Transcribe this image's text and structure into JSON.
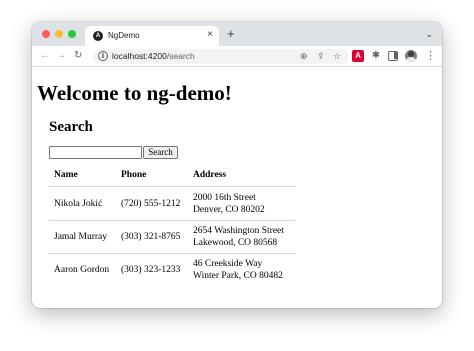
{
  "browser": {
    "tab_title": "NgDemo",
    "tab_favicon": "A",
    "tab_close": "×",
    "new_tab": "+",
    "tab_menu": "⌄",
    "url_host": "localhost:4200",
    "url_path": "/search",
    "icons": [
      "back-arrow-icon",
      "forward-arrow-icon",
      "reload-icon",
      "site-info-icon",
      "zoom-icon",
      "share-icon",
      "star-icon",
      "angular-extension-icon",
      "puzzle-extension-icon",
      "side-panel-icon",
      "profile-avatar",
      "kebab-menu-icon"
    ]
  },
  "page": {
    "heading": "Welcome to ng-demo!",
    "section_title": "Search",
    "search_value": "",
    "search_button": "Search"
  },
  "table": {
    "headers": [
      "Name",
      "Phone",
      "Address"
    ],
    "rows": [
      {
        "name": "Nikola Jokić",
        "phone": "(720) 555-1212",
        "address_line1": "2000 16th Street",
        "address_line2": "Denver, CO 80202"
      },
      {
        "name": "Jamal Murray",
        "phone": "(303) 321-8765",
        "address_line1": "2654 Washington Street",
        "address_line2": "Lakewood, CO 80568"
      },
      {
        "name": "Aaron Gordon",
        "phone": "(303) 323-1233",
        "address_line1": "46 Creekside Way",
        "address_line2": "Winter Park, CO 80482"
      }
    ]
  },
  "colors": {
    "tabstrip": "#dee1e6",
    "traffic_red": "#ff5f57",
    "traffic_yellow": "#febc2e",
    "traffic_green": "#28c840",
    "angular_red": "#dd0031"
  }
}
